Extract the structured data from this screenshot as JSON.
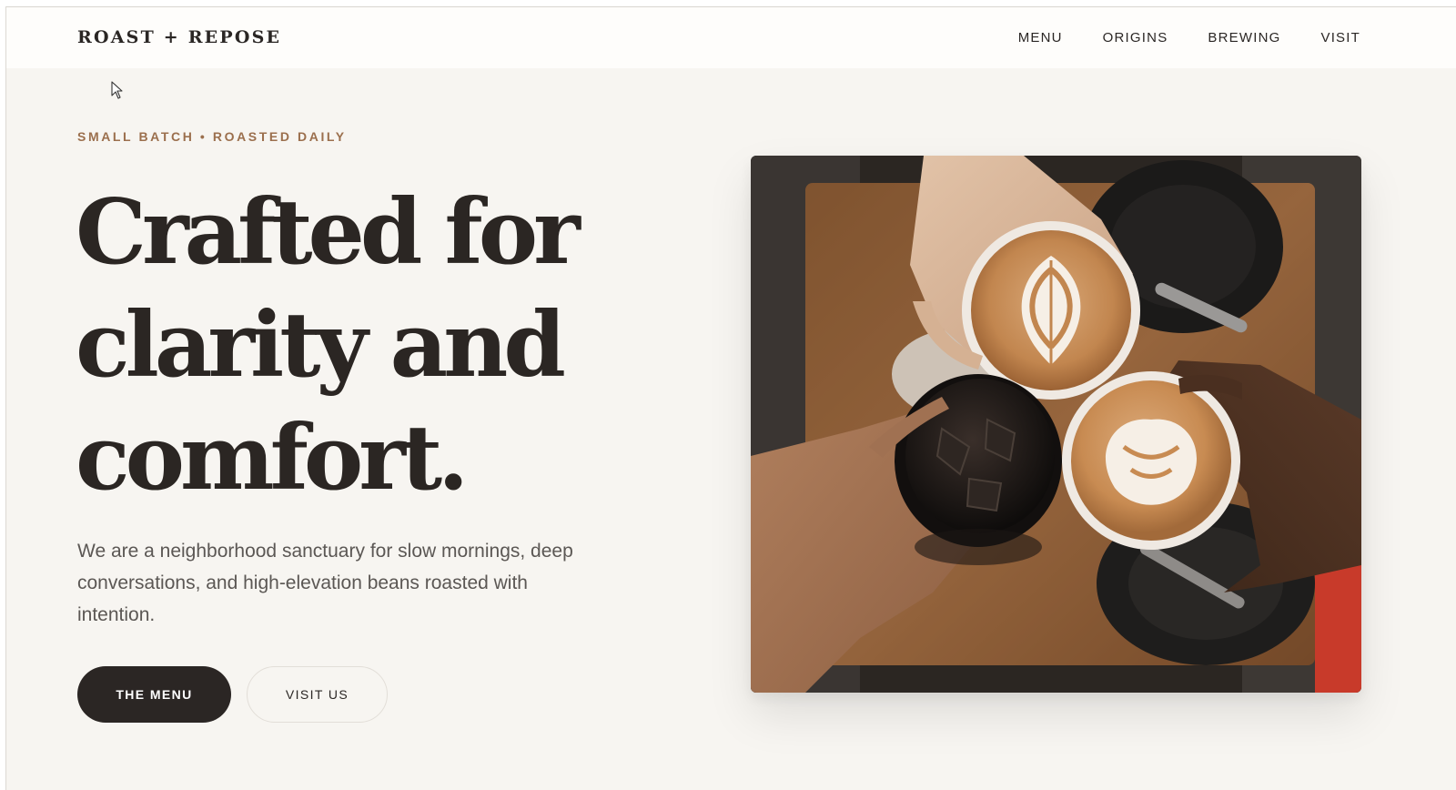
{
  "brand": {
    "name": "ROAST + REPOSE"
  },
  "nav": {
    "items": [
      {
        "label": "MENU"
      },
      {
        "label": "ORIGINS"
      },
      {
        "label": "BREWING"
      },
      {
        "label": "VISIT"
      }
    ]
  },
  "hero": {
    "eyebrow": "SMALL BATCH • ROASTED DAILY",
    "headline_lines": [
      "Crafted for",
      "clarity and",
      "comfort."
    ],
    "intro": "We are a neighborhood sanctuary for slow mornings, deep conversations, and high-elevation beans roasted with intention.",
    "primary_button": "THE MENU",
    "secondary_button": "VISIT US"
  },
  "image": {
    "icon": "coffee-photo",
    "accent_colors": {
      "background": "#f7f5f1",
      "eyebrow": "#9b6f4d",
      "ink": "#2b2624"
    }
  }
}
